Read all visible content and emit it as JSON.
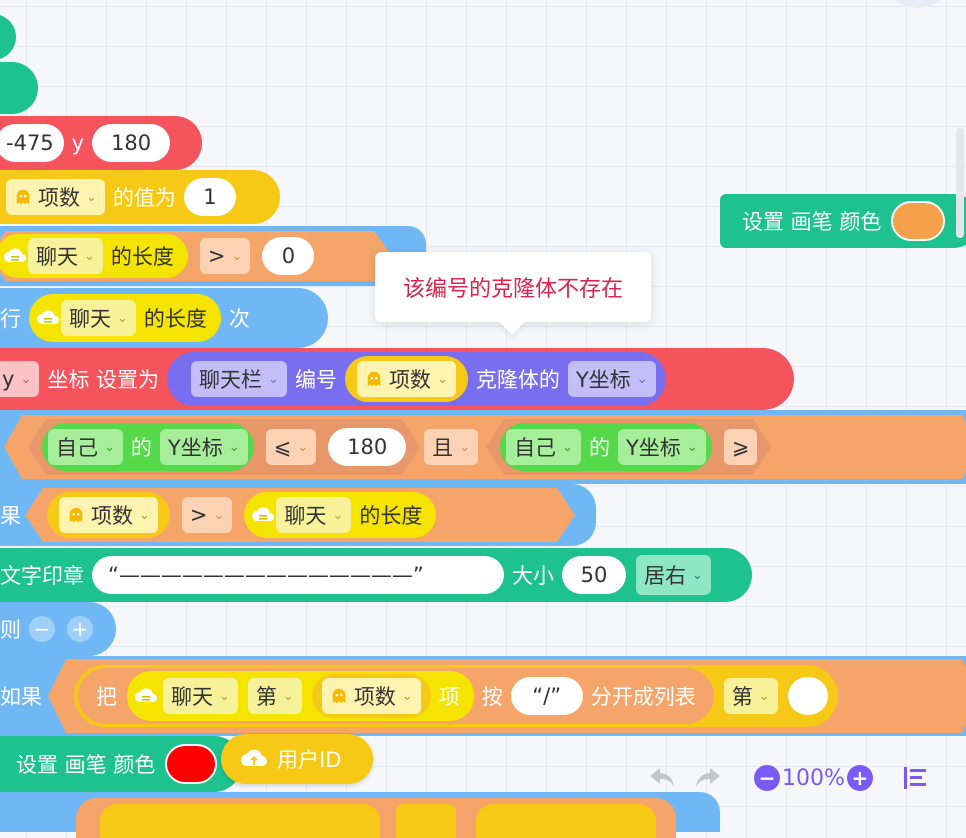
{
  "blocks": {
    "goto": {
      "x_value": "-475",
      "y_label": "y",
      "y_value": "180"
    },
    "set_var": {
      "var": "项数",
      "label": "的值为",
      "value": "1"
    },
    "while": {
      "list": "聊天",
      "label": "的长度",
      "op": ">",
      "value": "0"
    },
    "repeat": {
      "prefix": "行",
      "list": "聊天",
      "label": "的长度",
      "suffix": "次"
    },
    "set_coord": {
      "axis": "y",
      "label": "坐标 设置为",
      "sprite": "聊天栏",
      "num_label": "编号",
      "var": "项数",
      "clone_label": "克隆体的",
      "prop": "Y坐标"
    },
    "cond_and": {
      "self1": "自己",
      "of1": "的",
      "prop1": "Y坐标",
      "op1": "⩽",
      "val1": "180",
      "and": "且",
      "self2": "自己",
      "of2": "的",
      "prop2": "Y坐标",
      "op2": "⩾"
    },
    "if_block": {
      "prefix": "果",
      "var": "项数",
      "op": ">",
      "list": "聊天",
      "label": "的长度"
    },
    "stamp": {
      "prefix": "文字印章",
      "text": "“——————————————”",
      "size_label": "大小",
      "size": "50",
      "align": "居右"
    },
    "else": {
      "label": "则",
      "minus": "−",
      "plus": "+"
    },
    "if2": {
      "prefix": "如果",
      "ba": "把",
      "list": "聊天",
      "di": "第",
      "var": "项数",
      "xiang": "项",
      "an": "按",
      "sep": "“/”",
      "split_label": "分开成列表",
      "di2": "第"
    },
    "pen_color": {
      "label": "设置 画笔 颜色",
      "color": "#ff0000"
    },
    "user_id": {
      "label": "用户ID"
    },
    "floating_pen": {
      "label": "设置 画笔 颜色",
      "color": "#f5a04a"
    }
  },
  "tooltip": {
    "text": "该编号的克隆体不存在"
  },
  "zoom": {
    "undo_icon": "undo-icon",
    "redo_icon": "redo-icon",
    "zoom_out": "−",
    "level": "100%",
    "zoom_in": "+"
  },
  "colors": {
    "motion_red": "#f5545d",
    "control_blue": "#6fb8f5",
    "variable_yellow": "#f7c917",
    "pen_green": "#1dc28f",
    "operator_orange": "#f5a56a",
    "sensing_purple": "#7a6ef0",
    "list_yellow": "#f4e400",
    "tooltip_text": "#d9244f"
  }
}
